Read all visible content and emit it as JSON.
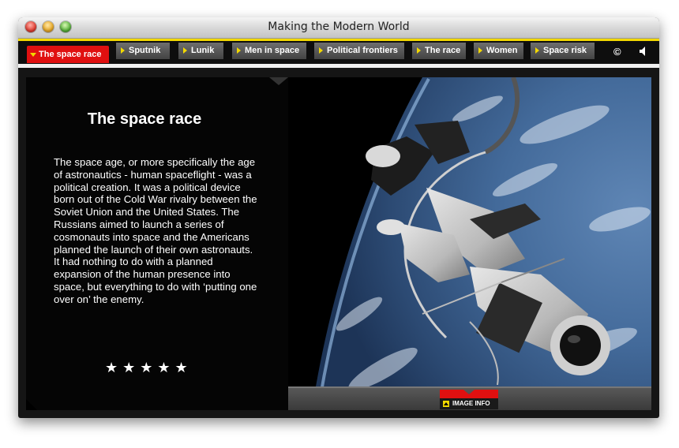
{
  "window": {
    "title": "Making the Modern World"
  },
  "nav": {
    "tabs": [
      {
        "label": "The space race",
        "active": true
      },
      {
        "label": "Sputnik"
      },
      {
        "label": "Lunik"
      },
      {
        "label": "Men in space"
      },
      {
        "label": "Political frontiers"
      },
      {
        "label": "The race"
      },
      {
        "label": "Women"
      },
      {
        "label": "Space risk"
      }
    ],
    "copyright_symbol": "©",
    "sound_icon": "speaker-icon"
  },
  "content": {
    "heading": "The space race",
    "body": "The space age, or more specifically the age of astronautics - human spaceflight - was a political creation. It was a political device born out of the Cold War rivalry between the Soviet Union and the United States. The Russians aimed to launch a series of cosmonauts into space and the Americans planned the launch of their own astronauts. It had nothing to do with a planned expansion of the human presence into space, but everything to do with ‘putting one over on’ the enemy.",
    "rating_stars": "★★★★★",
    "image_info_label": "IMAGE INFO"
  },
  "colors": {
    "accent_red": "#e01010",
    "accent_yellow": "#f2d800"
  }
}
